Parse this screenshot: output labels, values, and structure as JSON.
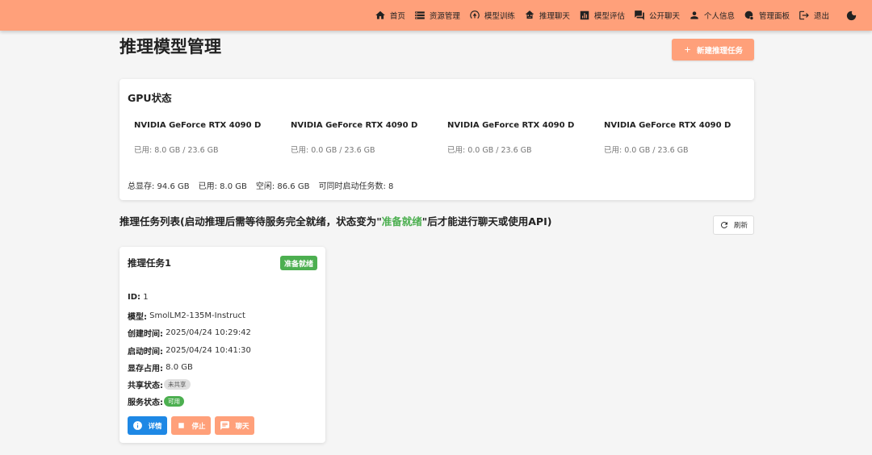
{
  "nav": {
    "items": [
      {
        "label": "首页",
        "icon": "home-icon"
      },
      {
        "label": "资源管理",
        "icon": "storage-icon"
      },
      {
        "label": "模型训练",
        "icon": "training-icon"
      },
      {
        "label": "推理聊天",
        "icon": "robot-icon"
      },
      {
        "label": "模型评估",
        "icon": "chart-icon"
      },
      {
        "label": "公开聊天",
        "icon": "forum-icon"
      },
      {
        "label": "个人信息",
        "icon": "person-icon"
      },
      {
        "label": "管理面板",
        "icon": "admin-icon"
      },
      {
        "label": "退出",
        "icon": "logout-icon"
      }
    ],
    "theme_icon": "moon-icon"
  },
  "page": {
    "title": "推理模型管理",
    "new_task_label": "新建推理任务"
  },
  "gpu": {
    "title": "GPU状态",
    "items": [
      {
        "name": "NVIDIA GeForce RTX 4090 D",
        "usage": "已用: 8.0 GB / 23.6 GB"
      },
      {
        "name": "NVIDIA GeForce RTX 4090 D",
        "usage": "已用: 0.0 GB / 23.6 GB"
      },
      {
        "name": "NVIDIA GeForce RTX 4090 D",
        "usage": "已用: 0.0 GB / 23.6 GB"
      },
      {
        "name": "NVIDIA GeForce RTX 4090 D",
        "usage": "已用: 0.0 GB / 23.6 GB"
      }
    ],
    "summary": {
      "total": "总显存: 94.6 GB",
      "used": "已用: 8.0 GB",
      "free": "空闲: 86.6 GB",
      "concurrent": "可同时启动任务数: 8"
    }
  },
  "tasks": {
    "title_prefix": "推理任务列表(启动推理后需等待服务完全就绪，状态变为\"",
    "title_highlight": "准备就绪",
    "title_suffix": "\"后才能进行聊天或使用API)",
    "refresh_label": "刷新",
    "items": [
      {
        "name": "推理任务1",
        "status": "准备就绪",
        "id_label": "ID:",
        "id_value": " 1",
        "model_label": "模型:",
        "model_value": " SmolLM2-135M-Instruct",
        "created_label": "创建时间:",
        "created_value": " 2025/04/24 10:29:42",
        "started_label": "启动时间:",
        "started_value": " 2025/04/24 10:41:30",
        "memory_label": "显存占用:",
        "memory_value": " 8.0 GB",
        "share_label": "共享状态:",
        "share_value": "未共享",
        "service_label": "服务状态:",
        "service_value": "可用",
        "detail_label": "详情",
        "stop_label": "停止",
        "chat_label": "聊天"
      }
    ]
  }
}
